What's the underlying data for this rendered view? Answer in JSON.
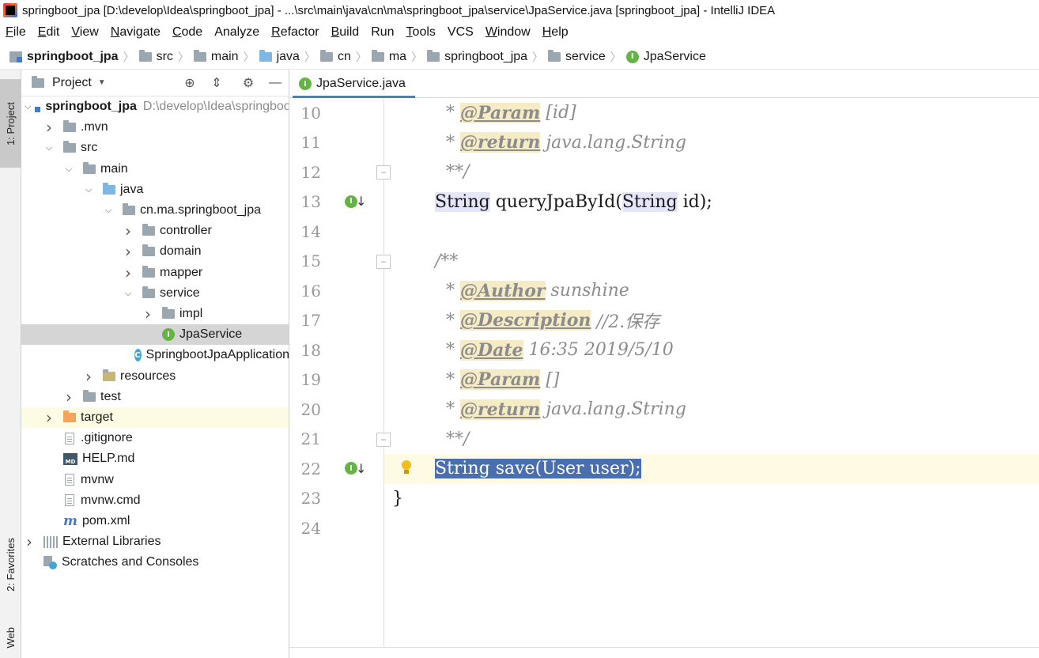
{
  "window": {
    "title": "springboot_jpa [D:\\develop\\Idea\\springboot_jpa] - ...\\src\\main\\java\\cn\\ma\\springboot_jpa\\service\\JpaService.java [springboot_jpa] - IntelliJ IDEA"
  },
  "menu": [
    {
      "m": "F",
      "rest": "ile"
    },
    {
      "m": "E",
      "rest": "dit"
    },
    {
      "m": "V",
      "rest": "iew"
    },
    {
      "m": "N",
      "rest": "avigate"
    },
    {
      "m": "C",
      "rest": "ode"
    },
    {
      "m": "",
      "rest": "Analyze"
    },
    {
      "m": "R",
      "rest": "efactor"
    },
    {
      "m": "B",
      "rest": "uild"
    },
    {
      "m": "",
      "rest": "Run"
    },
    {
      "m": "T",
      "rest": "ools"
    },
    {
      "m": "",
      "rest": "VCS"
    },
    {
      "m": "W",
      "rest": "indow"
    },
    {
      "m": "H",
      "rest": "elp"
    }
  ],
  "breadcrumb": [
    "springboot_jpa",
    "src",
    "main",
    "java",
    "cn",
    "ma",
    "springboot_jpa",
    "service",
    "JpaService"
  ],
  "toolstrip": {
    "project": "1: Project",
    "favorites": "2: Favorites",
    "web": "Web"
  },
  "project_panel": {
    "title": "Project",
    "root_name": "springboot_jpa",
    "root_path": "D:\\develop\\Idea\\springboot_jpa",
    "items": {
      "mvn": ".mvn",
      "src": "src",
      "main": "main",
      "java": "java",
      "pkg": "cn.ma.springboot_jpa",
      "controller": "controller",
      "domain": "domain",
      "mapper": "mapper",
      "service": "service",
      "impl": "impl",
      "jpaservice": "JpaService",
      "app": "SpringbootJpaApplication",
      "resources": "resources",
      "test": "test",
      "target": "target",
      "gitignore": ".gitignore",
      "help": "HELP.md",
      "mvnw": "mvnw",
      "mvnwcmd": "mvnw.cmd",
      "pom": "pom.xml",
      "extlib": "External Libraries",
      "scratches": "Scratches and Consoles"
    }
  },
  "editor": {
    "tab_label": "JpaService.java",
    "line_numbers": [
      "10",
      "11",
      "12",
      "13",
      "14",
      "15",
      "16",
      "17",
      "18",
      "19",
      "20",
      "21",
      "22",
      "23",
      "24"
    ],
    "code": {
      "l10_star": "* ",
      "l10_tag": "@Param",
      "l10_rest": " [id]",
      "l11_star": "* ",
      "l11_tag": "@return",
      "l11_rest": " java.lang.String",
      "l12": "**/",
      "l13_type1": "String",
      "l13_mid": " queryJpaById(",
      "l13_type2": "String",
      "l13_end": " id);",
      "l15": "/**",
      "l16_star": "* ",
      "l16_tag": "@Author",
      "l16_rest": " sunshine",
      "l17_star": "* ",
      "l17_tag": "@Description",
      "l17_rest": " //2.保存",
      "l18_star": "* ",
      "l18_tag": "@Date",
      "l18_rest": " 16:35 2019/5/10",
      "l19_star": "* ",
      "l19_tag": "@Param",
      "l19_rest": " []",
      "l20_star": "* ",
      "l20_tag": "@return",
      "l20_rest": " java.lang.String",
      "l21": "**/",
      "l22": "String save(User user);",
      "l23": "}"
    }
  },
  "colors": {
    "selection": "#4a6fb0",
    "current_line": "#fffae3",
    "interface_icon": "#62b543",
    "doc_tag_bg": "#f5ecc5"
  }
}
